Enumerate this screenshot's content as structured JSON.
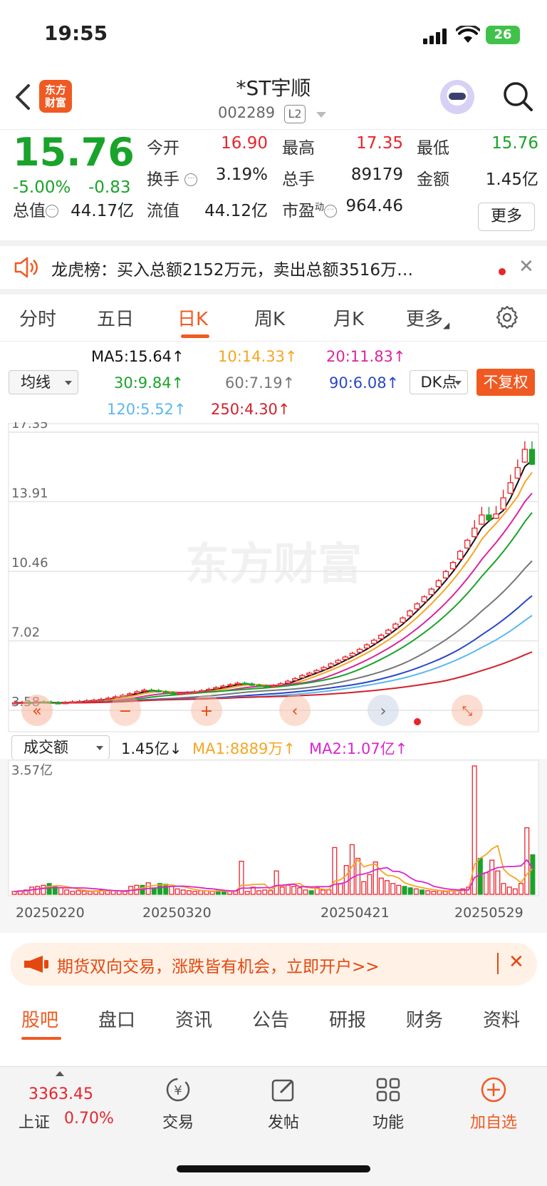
{
  "status": {
    "time": "19:55",
    "battery": "26"
  },
  "header": {
    "logo_line1": "东方",
    "logo_line2": "财富",
    "stock_name": "*ST宇顺",
    "stock_code": "002289",
    "level": "L2"
  },
  "quote": {
    "price": "15.76",
    "change_pct": "-5.00%",
    "change": "-0.83",
    "open_label": "今开",
    "open": "16.90",
    "high_label": "最高",
    "high": "17.35",
    "low_label": "最低",
    "low": "15.76",
    "turnover_label": "换手",
    "turnover": "3.19%",
    "volume_label": "总手",
    "volume": "89179",
    "amount_label": "金额",
    "amount": "1.45亿",
    "mktcap_label": "总值",
    "mktcap": "44.17亿",
    "float_label": "流值",
    "float_cap": "44.12亿",
    "pe_label": "市盈",
    "pe_sup": "动",
    "pe": "964.46",
    "more": "更多"
  },
  "notice": {
    "text": "龙虎榜：买入总额2152万元，卖出总额3516万…"
  },
  "period_tabs": [
    "分时",
    "五日",
    "日K",
    "周K",
    "月K",
    "更多"
  ],
  "period_active": 2,
  "indicators": {
    "ma_dropdown": "均线",
    "ma5": "MA5:15.64↑",
    "ma10": "10:14.33↑",
    "ma20": "20:11.83↑",
    "ma30": "30:9.84↑",
    "ma60": "60:7.19↑",
    "ma90": "90:6.08↑",
    "ma120": "120:5.52↑",
    "ma250": "250:4.30↑",
    "dk": "DK点",
    "fq": "不复权",
    "colors": {
      "ma5": "#111111",
      "ma10": "#f5a623",
      "ma20": "#d9269a",
      "ma30": "#1aa32a",
      "ma60": "#777777",
      "ma90": "#2a47c9",
      "ma120": "#5ab8f0",
      "ma250": "#d4202c"
    }
  },
  "chart_data": [
    {
      "type": "candlestick",
      "y_ticks": [
        "17.35",
        "13.91",
        "10.46",
        "7.02",
        "3.58"
      ],
      "ylim": [
        3.58,
        17.35
      ],
      "watermark": "东方财富",
      "closes": [
        3.95,
        3.97,
        3.96,
        4.0,
        3.98,
        3.95,
        3.92,
        3.96,
        4.0,
        4.02,
        4.05,
        4.08,
        4.12,
        4.18,
        4.25,
        4.32,
        4.4,
        4.5,
        4.58,
        4.55,
        4.5,
        4.45,
        4.4,
        4.42,
        4.45,
        4.5,
        4.55,
        4.62,
        4.7,
        4.78,
        4.85,
        4.92,
        4.88,
        4.82,
        4.78,
        4.75,
        4.8,
        4.9,
        5.02,
        5.15,
        5.3,
        5.42,
        5.55,
        5.7,
        5.88,
        6.05,
        6.22,
        6.4,
        6.6,
        6.82,
        7.05,
        7.3,
        7.55,
        7.85,
        8.15,
        8.5,
        8.85,
        9.2,
        9.58,
        10.0,
        10.45,
        10.9,
        11.45,
        12.0,
        12.6,
        13.25,
        13.0,
        13.3,
        14.1,
        14.85,
        15.6,
        16.5,
        15.76
      ],
      "series": [
        {
          "name": "MA5"
        },
        {
          "name": "10"
        },
        {
          "name": "20"
        },
        {
          "name": "30"
        },
        {
          "name": "60"
        },
        {
          "name": "90"
        },
        {
          "name": "120"
        },
        {
          "name": "250"
        }
      ]
    },
    {
      "type": "bar",
      "indicator_dropdown": "成交额",
      "current": "1.45亿↓",
      "ma1": "MA1:8889万↑",
      "ma2": "MA2:1.07亿↑",
      "y_max_label": "3.57亿",
      "ylim": [
        0,
        3.57
      ],
      "x_ticks": [
        "20250220",
        "20250320",
        "20250421",
        "20250529"
      ],
      "values": [
        0.08,
        0.1,
        0.12,
        0.2,
        0.22,
        0.25,
        0.3,
        0.22,
        0.18,
        0.12,
        0.08,
        0.1,
        0.09,
        0.08,
        0.1,
        0.12,
        0.1,
        0.1,
        0.09,
        0.08,
        0.22,
        0.25,
        0.25,
        0.32,
        0.18,
        0.3,
        0.28,
        0.22,
        0.15,
        0.12,
        0.1,
        0.08,
        0.1,
        0.09,
        0.08,
        0.1,
        0.09,
        0.08,
        0.09,
        0.92,
        0.08,
        0.2,
        0.1,
        0.12,
        0.1,
        0.65,
        0.2,
        0.25,
        0.22,
        0.18,
        0.12,
        0.1,
        0.18,
        0.12,
        0.12,
        1.3,
        0.3,
        0.8,
        1.38,
        1.0,
        0.35,
        0.55,
        0.9,
        0.45,
        0.38,
        0.3,
        0.25,
        0.22,
        0.18,
        0.15,
        0.12,
        0.1,
        0.08,
        0.1,
        0.08,
        0.1,
        0.12,
        0.15,
        0.2,
        3.57,
        1.0,
        0.6,
        0.95,
        0.65,
        0.3,
        0.2,
        0.15,
        0.3,
        1.85,
        1.1
      ],
      "down_days": [
        6,
        7,
        22,
        24,
        25,
        26,
        35,
        36,
        51,
        67,
        68,
        70,
        80,
        89
      ]
    }
  ],
  "banner": {
    "text": "期货双向交易，涨跌皆有机会，立即开户>>"
  },
  "section_tabs": [
    "股吧",
    "盘口",
    "资讯",
    "公告",
    "研报",
    "财务",
    "资料"
  ],
  "bottom_nav": {
    "index_value": "3363.45",
    "index_name": "上证",
    "index_pct": "0.70%",
    "trade": "交易",
    "post": "发帖",
    "features": "功能",
    "watch": "加自选"
  }
}
